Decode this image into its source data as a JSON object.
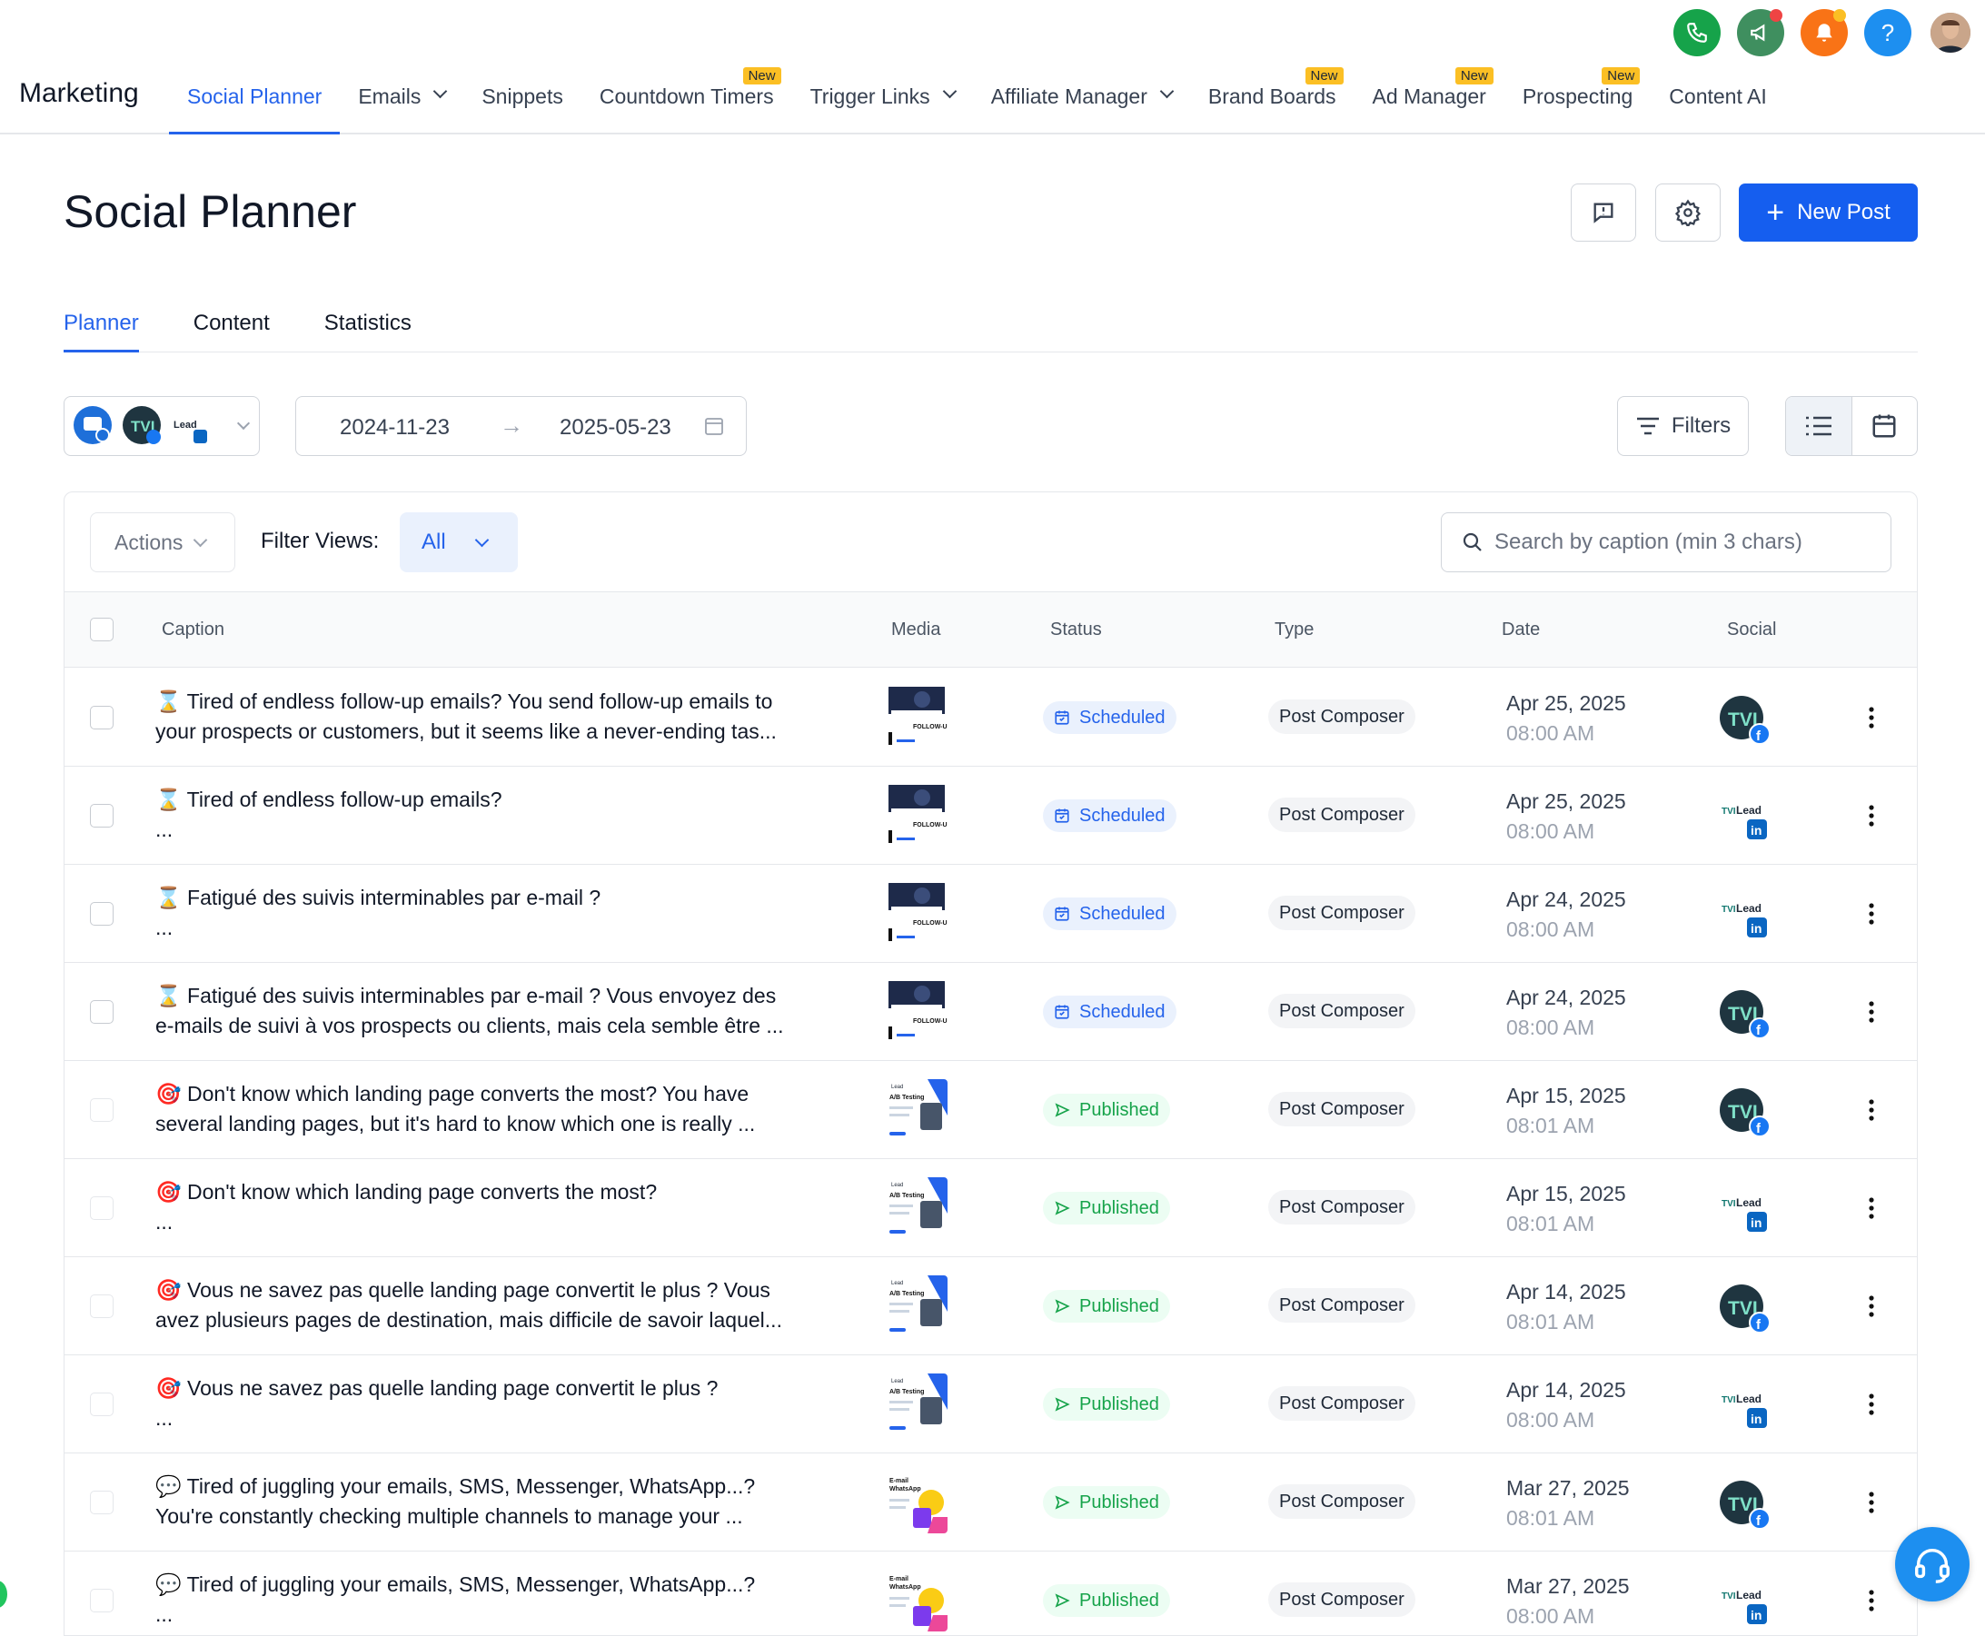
{
  "header": {
    "brand": "Marketing",
    "nav": [
      {
        "label": "Social Planner",
        "active": true,
        "dropdown": false,
        "badge": ""
      },
      {
        "label": "Emails",
        "active": false,
        "dropdown": true,
        "badge": ""
      },
      {
        "label": "Snippets",
        "active": false,
        "dropdown": false,
        "badge": ""
      },
      {
        "label": "Countdown Timers",
        "active": false,
        "dropdown": false,
        "badge": "New"
      },
      {
        "label": "Trigger Links",
        "active": false,
        "dropdown": true,
        "badge": ""
      },
      {
        "label": "Affiliate Manager",
        "active": false,
        "dropdown": true,
        "badge": ""
      },
      {
        "label": "Brand Boards",
        "active": false,
        "dropdown": false,
        "badge": "New"
      },
      {
        "label": "Ad Manager",
        "active": false,
        "dropdown": false,
        "badge": "New"
      },
      {
        "label": "Prospecting",
        "active": false,
        "dropdown": false,
        "badge": "New"
      },
      {
        "label": "Content AI",
        "active": false,
        "dropdown": false,
        "badge": ""
      }
    ],
    "icons": [
      "phone-icon",
      "megaphone-icon",
      "bell-icon",
      "help-icon",
      "avatar"
    ],
    "help_glyph": "?"
  },
  "page": {
    "title": "Social Planner",
    "new_post_label": "New Post",
    "tabs": [
      "Planner",
      "Content",
      "Statistics"
    ],
    "active_tab": "Planner"
  },
  "toolbar": {
    "date_start": "2024-11-23",
    "date_end": "2025-05-23",
    "filters_label": "Filters",
    "view_mode": "list"
  },
  "table": {
    "actions_label": "Actions",
    "filter_views_label": "Filter Views:",
    "filter_view_value": "All",
    "search_placeholder": "Search by caption (min 3 chars)",
    "columns": [
      "Caption",
      "Media",
      "Status",
      "Type",
      "Date",
      "Social"
    ],
    "rows": [
      {
        "emoji": "⌛",
        "line1": "Tired of endless follow-up emails? You send follow-up emails to",
        "line2": "your prospects or customers, but it seems like a never-ending tas...",
        "media": "follow-up",
        "status": "Scheduled",
        "type": "Post Composer",
        "date": "Apr 25, 2025",
        "time": "08:00 AM",
        "social": "facebook"
      },
      {
        "emoji": "⌛",
        "line1": "Tired of endless follow-up emails?",
        "line2": "...",
        "media": "follow-up",
        "status": "Scheduled",
        "type": "Post Composer",
        "date": "Apr 25, 2025",
        "time": "08:00 AM",
        "social": "linkedin"
      },
      {
        "emoji": "⌛",
        "line1": "Fatigué des suivis interminables par e-mail ?",
        "line2": "...",
        "media": "follow-up",
        "status": "Scheduled",
        "type": "Post Composer",
        "date": "Apr 24, 2025",
        "time": "08:00 AM",
        "social": "linkedin"
      },
      {
        "emoji": "⌛",
        "line1": "Fatigué des suivis interminables par e-mail ? Vous envoyez des",
        "line2": "e-mails de suivi à vos prospects ou clients, mais cela semble être ...",
        "media": "follow-up",
        "status": "Scheduled",
        "type": "Post Composer",
        "date": "Apr 24, 2025",
        "time": "08:00 AM",
        "social": "facebook"
      },
      {
        "emoji": "🎯",
        "line1": "Don't know which landing page converts the most? You have",
        "line2": "several landing pages, but it's hard to know which one is really ...",
        "media": "ab-testing",
        "status": "Published",
        "type": "Post Composer",
        "date": "Apr 15, 2025",
        "time": "08:01 AM",
        "social": "facebook"
      },
      {
        "emoji": "🎯",
        "line1": "Don't know which landing page converts the most?",
        "line2": "...",
        "media": "ab-testing",
        "status": "Published",
        "type": "Post Composer",
        "date": "Apr 15, 2025",
        "time": "08:01 AM",
        "social": "linkedin"
      },
      {
        "emoji": "🎯",
        "line1": "Vous ne savez pas quelle landing page convertit le plus ? Vous",
        "line2": "avez plusieurs pages de destination, mais difficile de savoir laquel...",
        "media": "ab-testing",
        "status": "Published",
        "type": "Post Composer",
        "date": "Apr 14, 2025",
        "time": "08:01 AM",
        "social": "facebook"
      },
      {
        "emoji": "🎯",
        "line1": "Vous ne savez pas quelle landing page convertit le plus ?",
        "line2": "...",
        "media": "ab-testing",
        "status": "Published",
        "type": "Post Composer",
        "date": "Apr 14, 2025",
        "time": "08:00 AM",
        "social": "linkedin"
      },
      {
        "emoji": "💬",
        "line1": "Tired of juggling your emails, SMS, Messenger, WhatsApp...?",
        "line2": "You're constantly checking multiple channels to manage your ...",
        "media": "email-whatsapp",
        "status": "Published",
        "type": "Post Composer",
        "date": "Mar 27, 2025",
        "time": "08:01 AM",
        "social": "facebook"
      },
      {
        "emoji": "💬",
        "line1": "Tired of juggling your emails, SMS, Messenger, WhatsApp...?",
        "line2": "...",
        "media": "email-whatsapp",
        "status": "Published",
        "type": "Post Composer",
        "date": "Mar 27, 2025",
        "time": "08:00 AM",
        "social": "linkedin"
      }
    ]
  },
  "colors": {
    "accent": "#155eef",
    "scheduled": "#2563eb",
    "published": "#16a34a",
    "new_badge": "#fbbf24",
    "phone": "#16a34a",
    "megaphone": "#15803d",
    "bell": "#f97316",
    "help": "#1d8ff0"
  }
}
